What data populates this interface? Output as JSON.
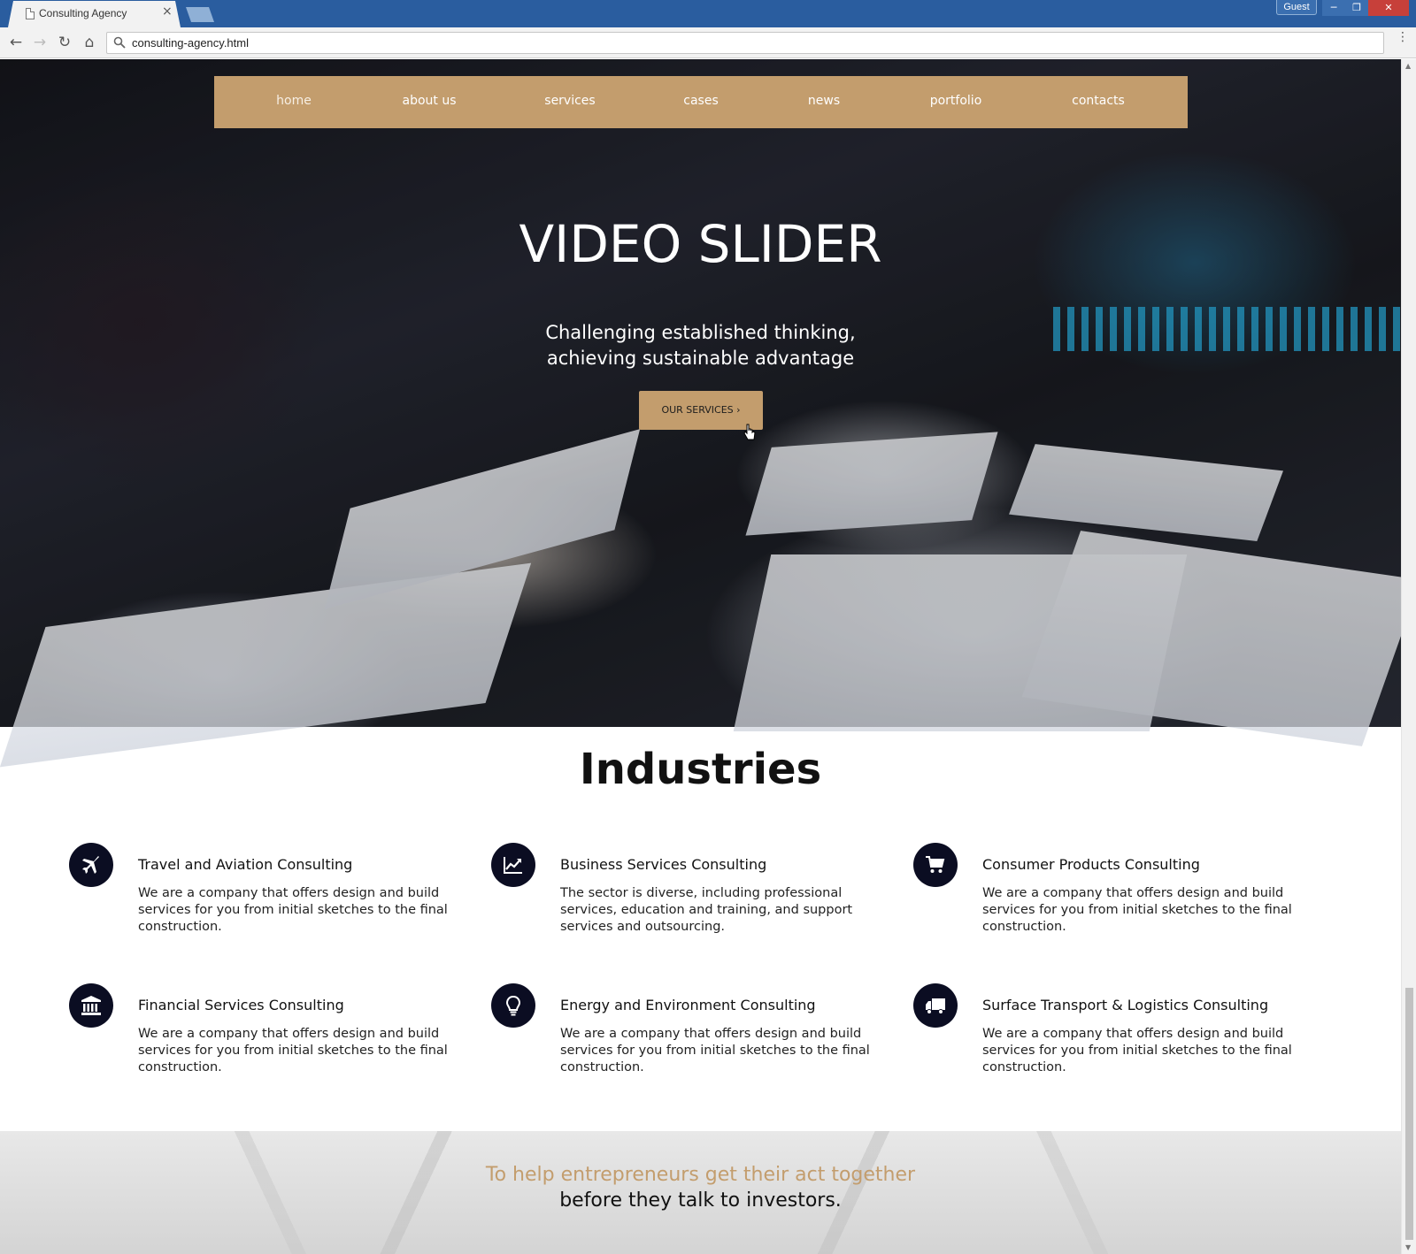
{
  "browser": {
    "tab_title": "Consulting Agency",
    "tab_close": "×",
    "profile_label": "Guest",
    "url": "consulting-agency.html"
  },
  "nav": {
    "items": [
      {
        "label": "home",
        "active": true
      },
      {
        "label": "about us",
        "active": false
      },
      {
        "label": "services",
        "active": false
      },
      {
        "label": "cases",
        "active": false
      },
      {
        "label": "news",
        "active": false
      },
      {
        "label": "portfolio",
        "active": false
      },
      {
        "label": "contacts",
        "active": false
      }
    ]
  },
  "hero": {
    "title": "VIDEO SLIDER",
    "subtitle_line1": "Challenging established thinking,",
    "subtitle_line2": "achieving sustainable advantage",
    "button_label": "OUR SERVICES ›"
  },
  "industries": {
    "title": "Industries",
    "items": [
      {
        "name": "Travel and Aviation Consulting",
        "icon": "plane-icon",
        "description": "We are a company that offers design and build services for you from initial sketches to the final construction."
      },
      {
        "name": "Business Services Consulting",
        "icon": "chart-line-icon",
        "description": "The sector is diverse, including professional services, education and training, and support services and outsourcing."
      },
      {
        "name": "Consumer Products Consulting",
        "icon": "cart-icon",
        "description": "We are a company that offers design and build services for you from initial sketches to the final construction."
      },
      {
        "name": "Financial Services Consulting",
        "icon": "bank-icon",
        "description": "We are a company that offers design and build services for you from initial sketches to the final construction."
      },
      {
        "name": "Energy and Environment Consulting",
        "icon": "lightbulb-icon",
        "description": "We are a company that offers design and build services for you from initial sketches to the final construction."
      },
      {
        "name": "Surface Transport & Logistics Consulting",
        "icon": "truck-icon",
        "description": "We are a company that offers design and build services for you from initial sketches to the final construction."
      }
    ]
  },
  "banner": {
    "line1": "To help entrepreneurs get their act together",
    "line2": "before they talk to investors."
  },
  "colors": {
    "accent": "#c39d6d",
    "icon_bg": "#0b0d22",
    "chrome_blue": "#2a5d9f"
  }
}
